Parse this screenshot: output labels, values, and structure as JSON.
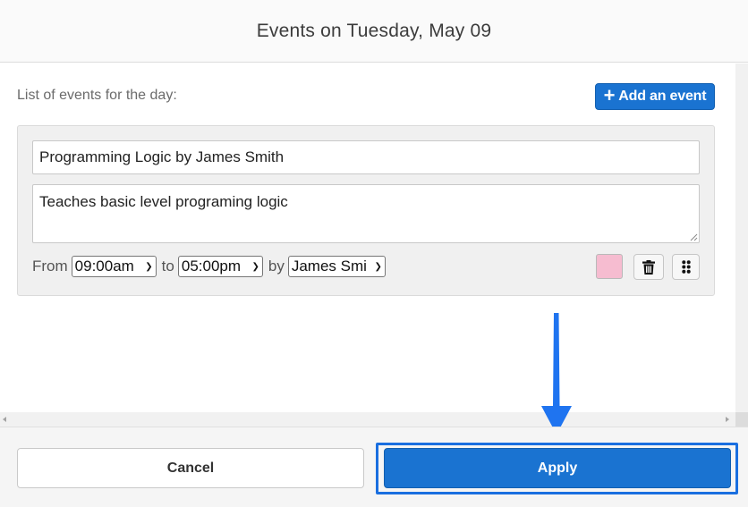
{
  "header": {
    "title": "Events on Tuesday, May 09"
  },
  "content": {
    "list_label": "List of events for the day:",
    "add_button_label": "Add an event",
    "add_button_icon": "plus-icon"
  },
  "event": {
    "title": "Programming Logic by James Smith",
    "description": "Teaches basic level programing logic",
    "from_label": "From",
    "from_time": "09:00am",
    "to_label": "to",
    "to_time": "05:00pm",
    "by_label": "by",
    "by_person": "James Smi",
    "color": "#f6bcd0",
    "delete_icon": "trash-icon",
    "drag_icon": "drag-handle-icon"
  },
  "footer": {
    "cancel_label": "Cancel",
    "apply_label": "Apply"
  },
  "annotation": {
    "arrow_color": "#1f74f0",
    "highlight_color": "#1a6fe0"
  }
}
